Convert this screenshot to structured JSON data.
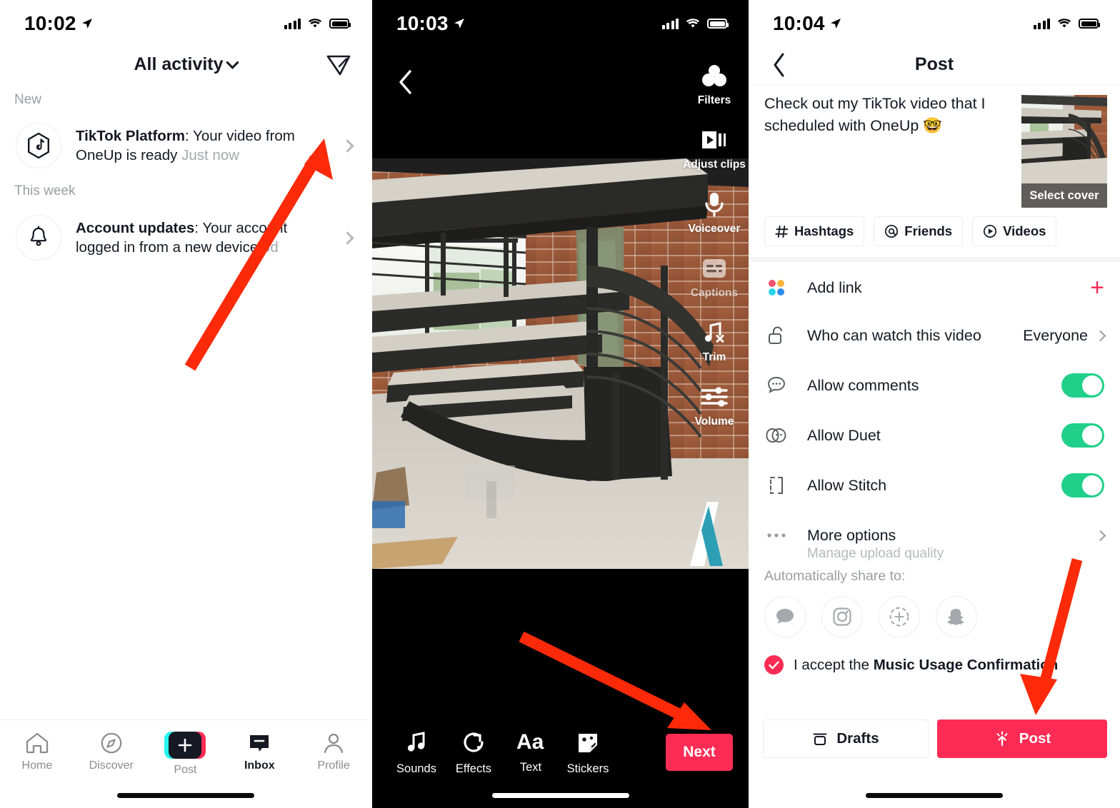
{
  "panels": {
    "inbox": {
      "status": {
        "time": "10:02"
      },
      "header": {
        "title": "All activity",
        "chevron_icon": "chevron-down-icon",
        "filter_icon": "inbox-filter-icon"
      },
      "sections": [
        {
          "label": "New"
        },
        {
          "label": "This week"
        }
      ],
      "notifications": [
        {
          "icon": "tiktok-platform-icon",
          "title": "TikTok Platform",
          "body": ": Your video from OneUp is ready",
          "time": "Just now"
        },
        {
          "icon": "bell-icon",
          "title": "Account updates",
          "body": ": Your account logged in from a new device",
          "time": "3d"
        }
      ],
      "tabs": [
        {
          "label": "Home",
          "icon": "home-icon",
          "active": false
        },
        {
          "label": "Discover",
          "icon": "compass-icon",
          "active": false
        },
        {
          "label": "Post",
          "icon": "plus-icon",
          "active": false
        },
        {
          "label": "Inbox",
          "icon": "inbox-icon",
          "active": true
        },
        {
          "label": "Profile",
          "icon": "person-icon",
          "active": false
        }
      ]
    },
    "editor": {
      "status": {
        "time": "10:03"
      },
      "back_icon": "chevron-left-icon",
      "watermark": "oneup-logo-watermark",
      "rail": [
        {
          "label": "Filters",
          "icon": "filters-icon",
          "dim": false
        },
        {
          "label": "Adjust clips",
          "icon": "adjust-clips-icon",
          "dim": false
        },
        {
          "label": "Voiceover",
          "icon": "microphone-icon",
          "dim": false
        },
        {
          "label": "Captions",
          "icon": "captions-icon",
          "dim": true
        },
        {
          "label": "Trim",
          "icon": "trim-music-icon",
          "dim": false
        },
        {
          "label": "Volume",
          "icon": "volume-sliders-icon",
          "dim": false
        }
      ],
      "bottom_tools": [
        {
          "label": "Sounds",
          "icon": "music-note-icon"
        },
        {
          "label": "Effects",
          "icon": "effects-icon"
        },
        {
          "label": "Text",
          "icon": "text-aa-icon"
        },
        {
          "label": "Stickers",
          "icon": "stickers-icon"
        }
      ],
      "next_label": "Next"
    },
    "post": {
      "status": {
        "time": "10:04"
      },
      "header": {
        "title": "Post",
        "back_icon": "chevron-left-icon"
      },
      "caption": "Check out my TikTok video that I scheduled with OneUp 🤓",
      "cover_label": "Select cover",
      "chips": [
        {
          "label": "Hashtags",
          "icon": "hashtag-icon"
        },
        {
          "label": "Friends",
          "icon": "at-mention-icon"
        },
        {
          "label": "Videos",
          "icon": "play-circle-icon"
        }
      ],
      "rows": {
        "add_link": {
          "label": "Add link",
          "icon": "four-dots-icon",
          "action": "+"
        },
        "privacy": {
          "label": "Who can watch this video",
          "icon": "lock-open-icon",
          "value": "Everyone"
        },
        "comments": {
          "label": "Allow comments",
          "icon": "comment-icon",
          "toggle": "on"
        },
        "duet": {
          "label": "Allow Duet",
          "icon": "duet-icon",
          "toggle": "on"
        },
        "stitch": {
          "label": "Allow Stitch",
          "icon": "stitch-icon",
          "toggle": "on"
        },
        "more": {
          "label": "More options",
          "icon": "ellipsis-icon",
          "sub": "Manage upload quality"
        }
      },
      "share": {
        "label": "Automatically share to:",
        "targets": [
          {
            "icon": "messages-bubble-icon"
          },
          {
            "icon": "instagram-icon"
          },
          {
            "icon": "instagram-story-icon"
          },
          {
            "icon": "snapchat-icon"
          }
        ]
      },
      "music_confirm": {
        "prefix": "I accept the ",
        "bold": "Music Usage Confirmation",
        "checked": true
      },
      "drafts_label": "Drafts",
      "post_label": "Post"
    }
  },
  "colors": {
    "tiktok_red": "#FE2C55",
    "tiktok_cyan": "#25F4EE",
    "toggle_green": "#20D08A",
    "annotation_arrow": "#FC2A09",
    "text_primary": "#161823",
    "text_muted": "#9b9da3"
  }
}
